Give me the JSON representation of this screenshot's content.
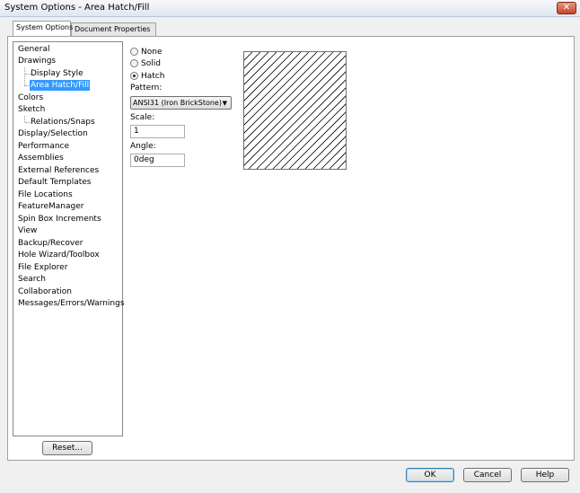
{
  "window": {
    "title": "System Options - Area Hatch/Fill"
  },
  "tabs": [
    {
      "label": "System Options",
      "active": true
    },
    {
      "label": "Document Properties",
      "active": false
    }
  ],
  "tree": [
    {
      "label": "General",
      "level": 0
    },
    {
      "label": "Drawings",
      "level": 0
    },
    {
      "label": "Display Style",
      "level": 1
    },
    {
      "label": "Area Hatch/Fill",
      "level": 1,
      "selected": true
    },
    {
      "label": "Colors",
      "level": 0
    },
    {
      "label": "Sketch",
      "level": 0
    },
    {
      "label": "Relations/Snaps",
      "level": 1
    },
    {
      "label": "Display/Selection",
      "level": 0
    },
    {
      "label": "Performance",
      "level": 0
    },
    {
      "label": "Assemblies",
      "level": 0
    },
    {
      "label": "External References",
      "level": 0
    },
    {
      "label": "Default Templates",
      "level": 0
    },
    {
      "label": "File Locations",
      "level": 0
    },
    {
      "label": "FeatureManager",
      "level": 0
    },
    {
      "label": "Spin Box Increments",
      "level": 0
    },
    {
      "label": "View",
      "level": 0
    },
    {
      "label": "Backup/Recover",
      "level": 0
    },
    {
      "label": "Hole Wizard/Toolbox",
      "level": 0
    },
    {
      "label": "File Explorer",
      "level": 0
    },
    {
      "label": "Search",
      "level": 0
    },
    {
      "label": "Collaboration",
      "level": 0
    },
    {
      "label": "Messages/Errors/Warnings",
      "level": 0
    }
  ],
  "fill_options": {
    "none_label": "None",
    "solid_label": "Solid",
    "hatch_label": "Hatch",
    "selected": "Hatch"
  },
  "pattern": {
    "label": "Pattern:",
    "value": "ANSI31 (Iron BrickStone)"
  },
  "scale": {
    "label": "Scale:",
    "value": "1"
  },
  "angle": {
    "label": "Angle:",
    "value": "0deg"
  },
  "buttons": {
    "reset": "Reset...",
    "ok": "OK",
    "cancel": "Cancel",
    "help": "Help"
  },
  "icons": {
    "close": "close-icon",
    "dropdown": "chevron-down-icon"
  },
  "colors": {
    "selection": "#3399ff",
    "close": "#c8462a"
  }
}
